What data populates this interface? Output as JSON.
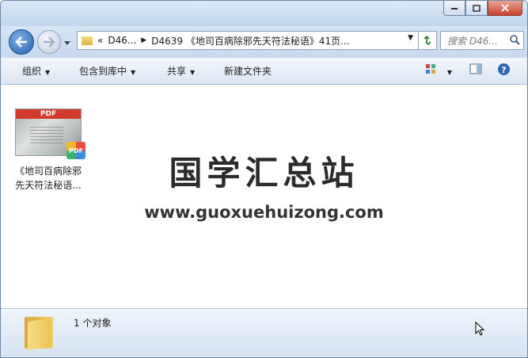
{
  "window": {
    "controls": {
      "minimize": "minimize-icon",
      "maximize": "maximize-icon",
      "close": "close-icon"
    }
  },
  "address": {
    "chevrons": "«",
    "crumbs": [
      "D46...",
      "D4639 《地司百病除邪先天符法秘语》41页..."
    ]
  },
  "search": {
    "placeholder": "搜索 D46..."
  },
  "toolbar": {
    "organize": "组织",
    "include_library": "包含到库中",
    "share": "共享",
    "new_folder": "新建文件夹"
  },
  "files": [
    {
      "name_line1": "《地司百病除邪",
      "name_line2": "先天符法秘语...",
      "type": "pdf",
      "thumb_label": "PDF",
      "badge": "PDF"
    }
  ],
  "watermark": {
    "title": "国学汇总站",
    "url": "www.guoxuehuizong.com"
  },
  "status": {
    "count_text": "1 个对象"
  },
  "colors": {
    "accent": "#245fa8",
    "close_button": "#c7432f",
    "pdf_red": "#d23b2c"
  }
}
